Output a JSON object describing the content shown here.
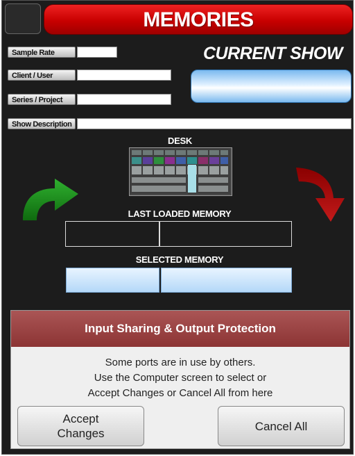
{
  "header": {
    "title": "MEMORIES"
  },
  "fields": {
    "sample_rate": {
      "label": "Sample Rate",
      "value": ""
    },
    "client_user": {
      "label": "Client / User",
      "value": ""
    },
    "series_project": {
      "label": "Series / Project",
      "value": ""
    },
    "show_description": {
      "label": "Show Description",
      "value": ""
    }
  },
  "current_show": {
    "label": "CURRENT SHOW",
    "value": ""
  },
  "desk": {
    "label": "DESK"
  },
  "last_loaded_memory": {
    "label": "LAST LOADED MEMORY",
    "left": "",
    "right": ""
  },
  "selected_memory": {
    "label": "SELECTED MEMORY",
    "left": "",
    "right": ""
  },
  "modal": {
    "title": "Input Sharing & Output Protection",
    "message_line1": "Some ports are in use by others.",
    "message_line2": "Use the Computer screen to select or",
    "message_line3": "Accept Changes or Cancel All from here",
    "accept_label_line1": "Accept",
    "accept_label_line2": "Changes",
    "cancel_label": "Cancel All"
  },
  "colors": {
    "title_red": "#c80000",
    "store_arrow_green": "#1f8f1f",
    "recall_arrow_red": "#8a0000",
    "modal_header": "#8c3434",
    "selected_memory_blue": "#cfe6ff"
  }
}
